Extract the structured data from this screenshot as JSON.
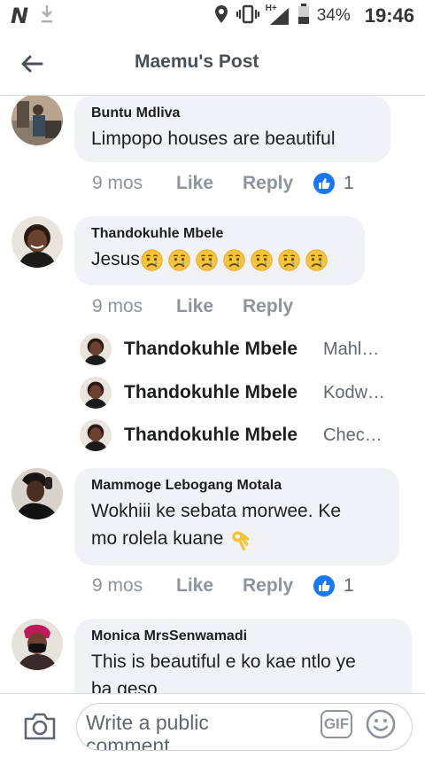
{
  "status_bar": {
    "app_logo": "N",
    "network": "H+",
    "battery": "34%",
    "time": "19:46"
  },
  "header": {
    "title": "Maemu's Post"
  },
  "comments": [
    {
      "name": "Buntu Mdliva",
      "text": "Limpopo houses are beautiful",
      "time": "9 mos",
      "like_label": "Like",
      "reply_label": "Reply",
      "reactions": "1"
    },
    {
      "name": "Thandokuhle Mbele",
      "text": "Jesus",
      "emoji": [
        "sad-face",
        "sad-face",
        "sad-face",
        "sad-face",
        "sad-face",
        "sad-face",
        "sad-face"
      ],
      "time": "9 mos",
      "like_label": "Like",
      "reply_label": "Reply",
      "replies": [
        {
          "name": "Thandokuhle Mbele",
          "preview": "Mahl…"
        },
        {
          "name": "Thandokuhle Mbele",
          "preview": "Kodw…"
        },
        {
          "name": "Thandokuhle Mbele",
          "preview": "Chec…"
        }
      ]
    },
    {
      "name": "Mammoge Lebogang Motala",
      "text_line1": "Wokhiii  ke sebata morwee. Ke",
      "text_line2": "mo rolela kuane",
      "emoji": [
        "ok-hand"
      ],
      "time": "9 mos",
      "like_label": "Like",
      "reply_label": "Reply",
      "reactions": "1"
    },
    {
      "name": "Monica MrsSenwamadi",
      "text_line1": "This is beautiful e ko kae ntlo ye",
      "text_line2": "ba geso"
    }
  ],
  "composer": {
    "placeholder": "Write a public comment…",
    "gif_label": "GIF"
  },
  "colors": {
    "accent": "#1877f2",
    "bubble": "#f0f2f5",
    "meta_text": "#8d949e",
    "emoji": "#f7c338"
  },
  "icons": [
    "back-arrow-icon",
    "camera-icon",
    "gif-icon",
    "smiley-icon",
    "like-thumb-icon",
    "location-icon",
    "vibrate-icon",
    "signal-icon",
    "battery-icon",
    "download-icon"
  ]
}
